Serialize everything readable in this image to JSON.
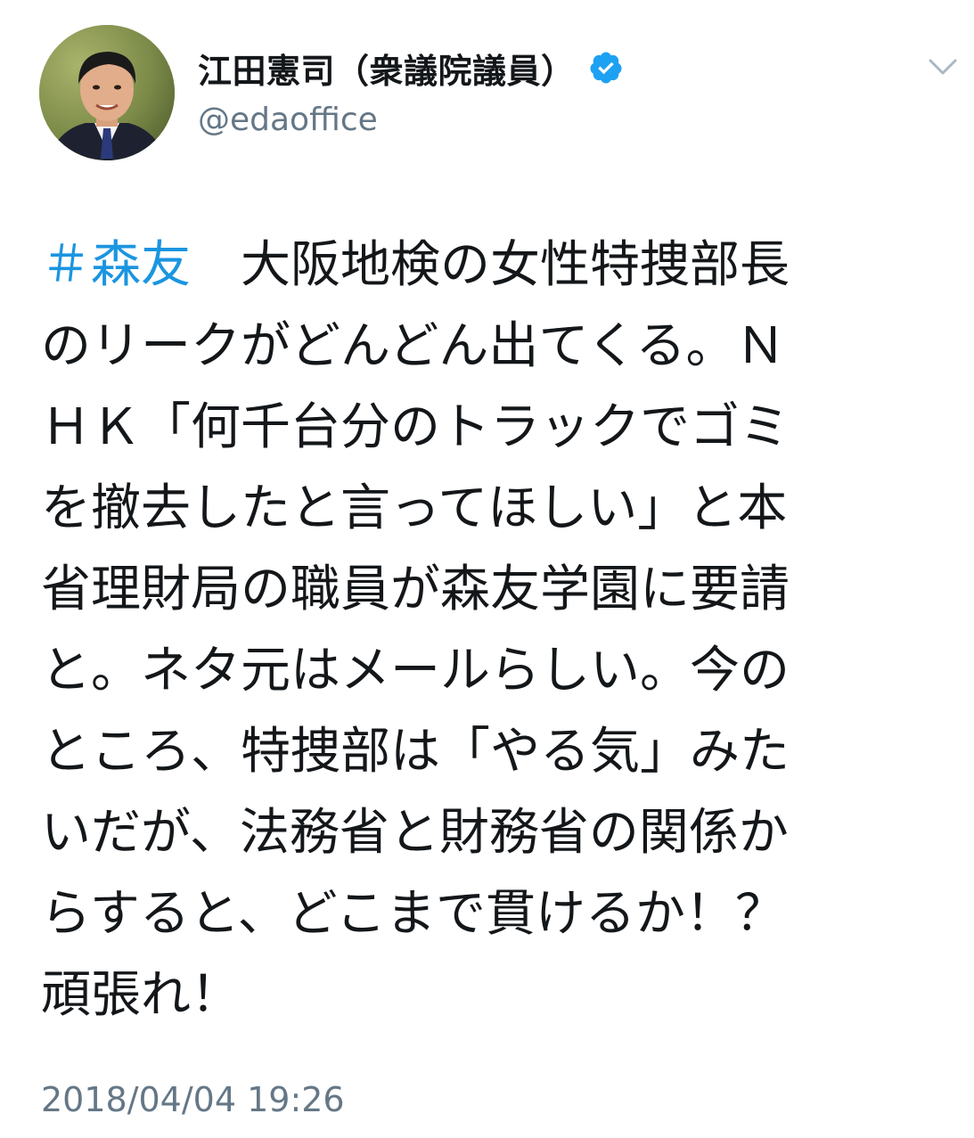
{
  "author": {
    "display_name": "江田憲司（衆議院議員）",
    "handle": "@edaoffice",
    "verified": true
  },
  "icons": {
    "verified": "verified-badge-icon",
    "caret": "chevron-down-icon"
  },
  "colors": {
    "hashtag": "#1b95e0",
    "verified_badge": "#1da1f2",
    "secondary_text": "#657786",
    "primary_text": "#14171a"
  },
  "tweet": {
    "hashtag": "＃森友",
    "lines": [
      "　大阪地検の女性特捜部長",
      "のリークがどんどん出てくる。Ｎ",
      "ＨＫ「何千台分のトラックでゴミ",
      "を撤去したと言ってほしい」と本",
      "省理財局の職員が森友学園に要請",
      "と。ネタ元はメールらしい。今の",
      "ところ、特捜部は「やる気」みた",
      "いだが、法務省と財務省の関係か",
      "らすると、どこまで貫けるか！？",
      "頑張れ！"
    ],
    "timestamp": "2018/04/04 19:26"
  }
}
